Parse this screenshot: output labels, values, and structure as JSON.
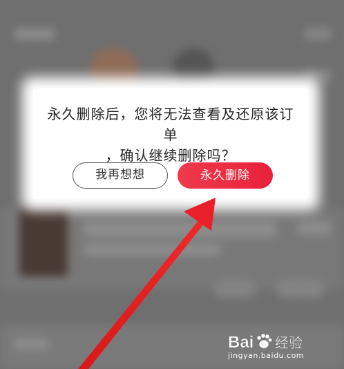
{
  "dialog": {
    "message_line1": "永久删除后，您将无法查看及还原该订单",
    "message_line2": "，确认继续删除吗？",
    "cancel_label": "我再想想",
    "confirm_label": "永久删除"
  },
  "watermark": {
    "logo_text": "Bai经验",
    "url": "jingyan.baidu.com"
  },
  "colors": {
    "confirm_gradient_start": "#ef3b4c",
    "confirm_gradient_end": "#e8213a",
    "arrow": "#e8202a"
  }
}
